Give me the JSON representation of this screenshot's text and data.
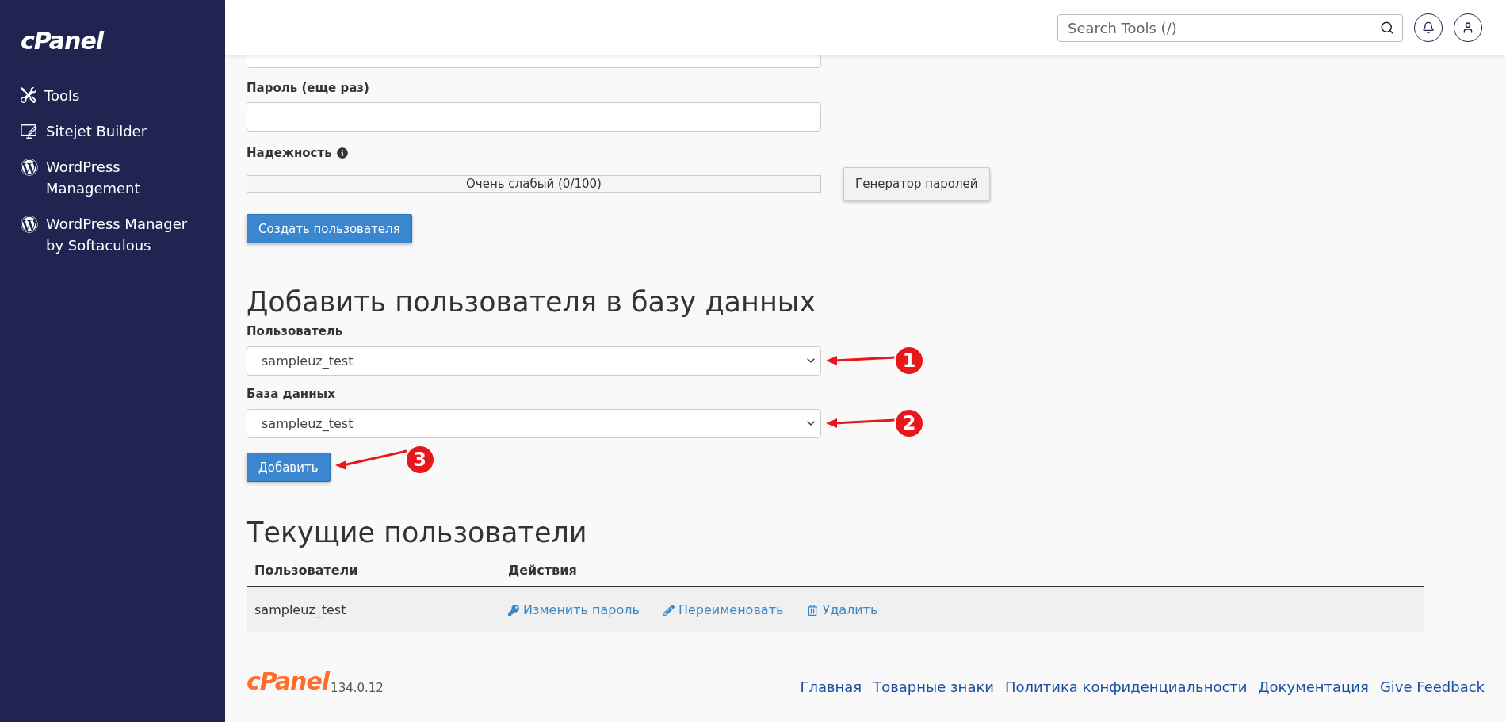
{
  "sidebar": {
    "logo": "cPanel",
    "items": [
      {
        "kind": "tools",
        "label": "Tools"
      },
      {
        "kind": "sitejet",
        "label": "Sitejet Builder"
      },
      {
        "kind": "wordpress",
        "label": "WordPress Management"
      },
      {
        "kind": "wordpress",
        "label": "WordPress Manager by Softaculous"
      }
    ]
  },
  "header": {
    "search": {
      "placeholder": "Search Tools (/)"
    }
  },
  "create_user_form": {
    "password_again": {
      "label": "Пароль (еще раз)"
    },
    "strength": {
      "label": "Надежность",
      "reading": "Очень слабый (0/100)",
      "level": 0
    },
    "generator_button": "Генератор паролей",
    "submit": "Создать пользователя"
  },
  "add_user_form": {
    "title": "Добавить пользователя в базу данных",
    "fields": [
      {
        "label": "Пользователь",
        "value": "sampleuz_test",
        "annotation": "1"
      },
      {
        "label": "База данных",
        "value": "sampleuz_test",
        "annotation": "2"
      }
    ],
    "submit": "Добавить",
    "submit_annotation": "3"
  },
  "current_users": {
    "title": "Текущие пользователи",
    "columns": [
      "Пользователи",
      "Действия"
    ],
    "rows": [
      {
        "user": "sampleuz_test",
        "actions": [
          {
            "kind": "key",
            "label": "Изменить пароль"
          },
          {
            "kind": "pencil",
            "label": "Переименовать"
          },
          {
            "kind": "trash",
            "label": "Удалить"
          }
        ]
      }
    ]
  },
  "footer": {
    "logo": "cPanel",
    "version": "134.0.12",
    "links": [
      "Главная",
      "Товарные знаки",
      "Политика конфиденциальности",
      "Документация",
      "Give Feedback"
    ]
  }
}
